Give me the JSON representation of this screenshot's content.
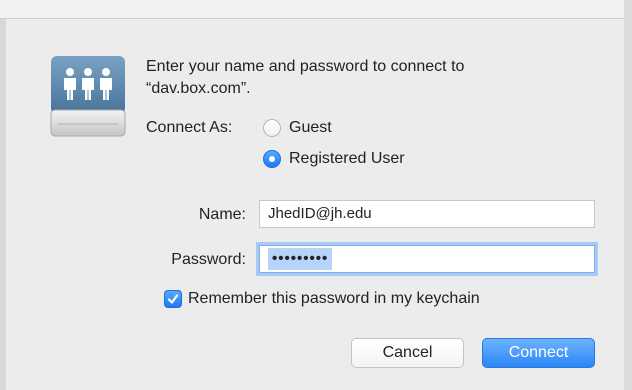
{
  "dialog": {
    "prompt_line1": "Enter your name and password to connect to",
    "prompt_line2": "“dav.box.com”.",
    "connect_as_label": "Connect As:",
    "guest_label": "Guest",
    "registered_label": "Registered User",
    "selected_option": "Registered User",
    "name_label": "Name:",
    "name_value": "JhedID@jh.edu",
    "password_label": "Password:",
    "password_value": "•••••••••",
    "remember_label": "Remember this password in my keychain",
    "remember_checked": true,
    "cancel_label": "Cancel",
    "connect_label": "Connect"
  },
  "icons": {
    "server": "shared-server-icon",
    "checkbox": "checkmark-icon"
  },
  "colors": {
    "accent": "#2c86f5",
    "selection": "#b5d3fb"
  }
}
